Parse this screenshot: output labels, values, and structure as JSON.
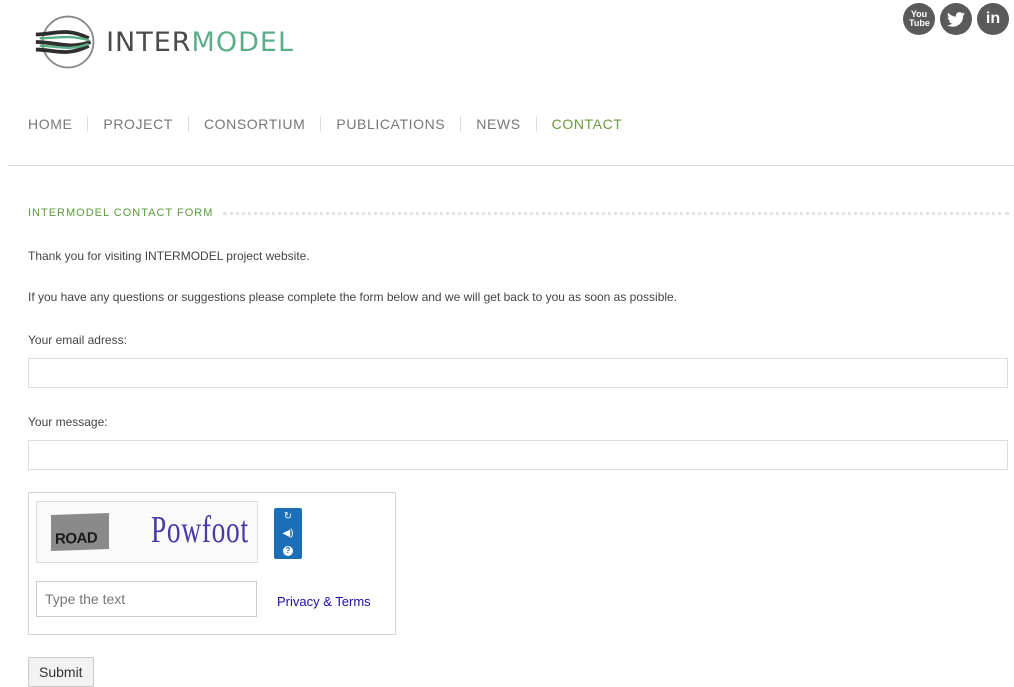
{
  "header": {
    "logo": {
      "text_main": "INTER",
      "text_accent": "MODEL"
    },
    "social": [
      {
        "icon": "youtube-icon",
        "label": "You Tube"
      },
      {
        "icon": "twitter-icon",
        "label": ""
      },
      {
        "icon": "linkedin-icon",
        "label": "in"
      }
    ]
  },
  "nav": {
    "items": [
      {
        "label": "HOME",
        "active": false
      },
      {
        "label": "PROJECT",
        "active": false
      },
      {
        "label": "CONSORTIUM",
        "active": false
      },
      {
        "label": "PUBLICATIONS",
        "active": false
      },
      {
        "label": "NEWS",
        "active": false
      },
      {
        "label": "CONTACT",
        "active": true
      }
    ]
  },
  "form": {
    "title": "INTERMODEL CONTACT FORM",
    "intro1": "Thank you for visiting INTERMODEL project website.",
    "intro2": "If you have any questions or suggestions please complete the form below and we will get back to you as soon as possible.",
    "email_label": "Your email adress:",
    "email_value": "",
    "message_label": "Your message:",
    "message_value": "",
    "captcha": {
      "word1": "ROAD",
      "word2": "Powfoot",
      "input_placeholder": "Type the text",
      "privacy_label": "Privacy & Terms"
    },
    "submit_label": "Submit"
  },
  "colors": {
    "accent": "#6a9a3a",
    "link": "#1a0dab",
    "captcha_blue": "#1c6fb7"
  }
}
